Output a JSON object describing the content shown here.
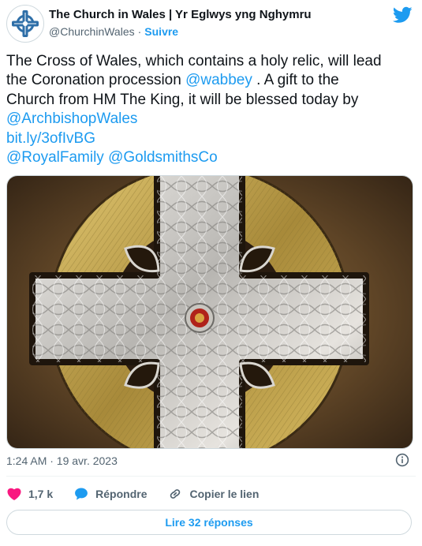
{
  "account": {
    "display_name": "The Church in Wales | Yr Eglwys yng Nghymru",
    "handle": "@ChurchinWales",
    "separator": "·",
    "follow_label": "Suivre",
    "avatar_icon": "celtic-cross-logo",
    "platform_icon": "twitter-bird-icon"
  },
  "tweet": {
    "lines": [
      [
        {
          "t": "The Cross of Wales, which contains a holy relic, will lead",
          "link": false
        }
      ],
      [
        {
          "t": "the Coronation procession ",
          "link": false
        },
        {
          "t": "@wabbey",
          "link": true
        },
        {
          "t": " . A gift to the",
          "link": false
        }
      ],
      [
        {
          "t": "Church from HM The King, it will be blessed today by",
          "link": false
        }
      ],
      [
        {
          "t": "@ArchbishopWales",
          "link": true
        }
      ],
      [
        {
          "t": "bit.ly/3ofIvBG",
          "link": true
        }
      ],
      [
        {
          "t": "@RoyalFamily",
          "link": true
        },
        {
          "t": " ",
          "link": false
        },
        {
          "t": "@GoldsmithsCo",
          "link": true
        }
      ]
    ]
  },
  "media": {
    "description_icon": "photo-image"
  },
  "meta": {
    "timestamp": "1:24 AM · 19 avr. 2023",
    "info_icon": "info-icon"
  },
  "actions": {
    "like_count": "1,7 k",
    "reply_label": "Répondre",
    "copy_link_label": "Copier le lien"
  },
  "replies_button": {
    "label": "Lire 32 réponses"
  },
  "colors": {
    "accent": "#1d9bf0",
    "heart": "#f91880",
    "text": "#0f1419",
    "secondary": "#536471"
  }
}
